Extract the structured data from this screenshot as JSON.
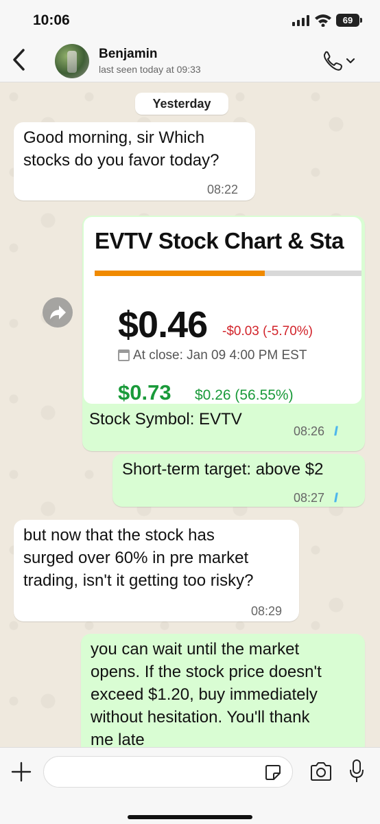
{
  "status_bar": {
    "time": "10:06",
    "battery": "69",
    "icons": [
      "signal-icon",
      "wifi-icon",
      "battery-icon"
    ]
  },
  "header": {
    "back_icon": "chevron-left-icon",
    "contact_name": "Benjamin",
    "contact_status": "last seen today at 09:33",
    "call_icon": "phone-icon"
  },
  "chat": {
    "date_chip": "Yesterday",
    "messages": [
      {
        "direction": "in",
        "lines": [
          "Good morning, sir  Which",
          "stocks do you favor today?"
        ],
        "time": "08:22"
      },
      {
        "direction": "out",
        "type": "image",
        "caption": "Stock Symbol: EVTV",
        "time": "08:26",
        "read": true
      },
      {
        "direction": "out",
        "lines": [
          "Short-term target: above $2"
        ],
        "time": "08:27",
        "read": true
      },
      {
        "direction": "in",
        "lines": [
          "but now that the stock has",
          "surged over 60% in pre  market",
          "trading, isn't it getting too risky?"
        ],
        "time": "08:29"
      },
      {
        "direction": "out",
        "lines": [
          "you can wait until the market",
          "opens. If the stock price doesn't",
          "exceed $1.20, buy immediately",
          "without hesitation. You'll thank",
          "me late"
        ]
      }
    ],
    "image": {
      "title": "EVTV Stock Chart & Sta",
      "progress_fraction": 0.62,
      "price": "$0.46",
      "change": "-$0.03 (-5.70%)",
      "close_info": "At close: Jan 09 4:00 PM EST",
      "premarket_price": "$0.73",
      "premarket_change": "$0.26 (56.55%)"
    },
    "colors": {
      "incoming_bubble": "#ffffff",
      "outgoing_bubble": "#d9fdd3",
      "read_ticks": "#4fb6ec",
      "negative": "#d2232a",
      "positive": "#1a9a3a",
      "progress": "#f08a00"
    }
  },
  "input_bar": {
    "placeholder": "",
    "icons": [
      "plus-icon",
      "sticker-icon",
      "camera-icon",
      "microphone-icon"
    ]
  }
}
